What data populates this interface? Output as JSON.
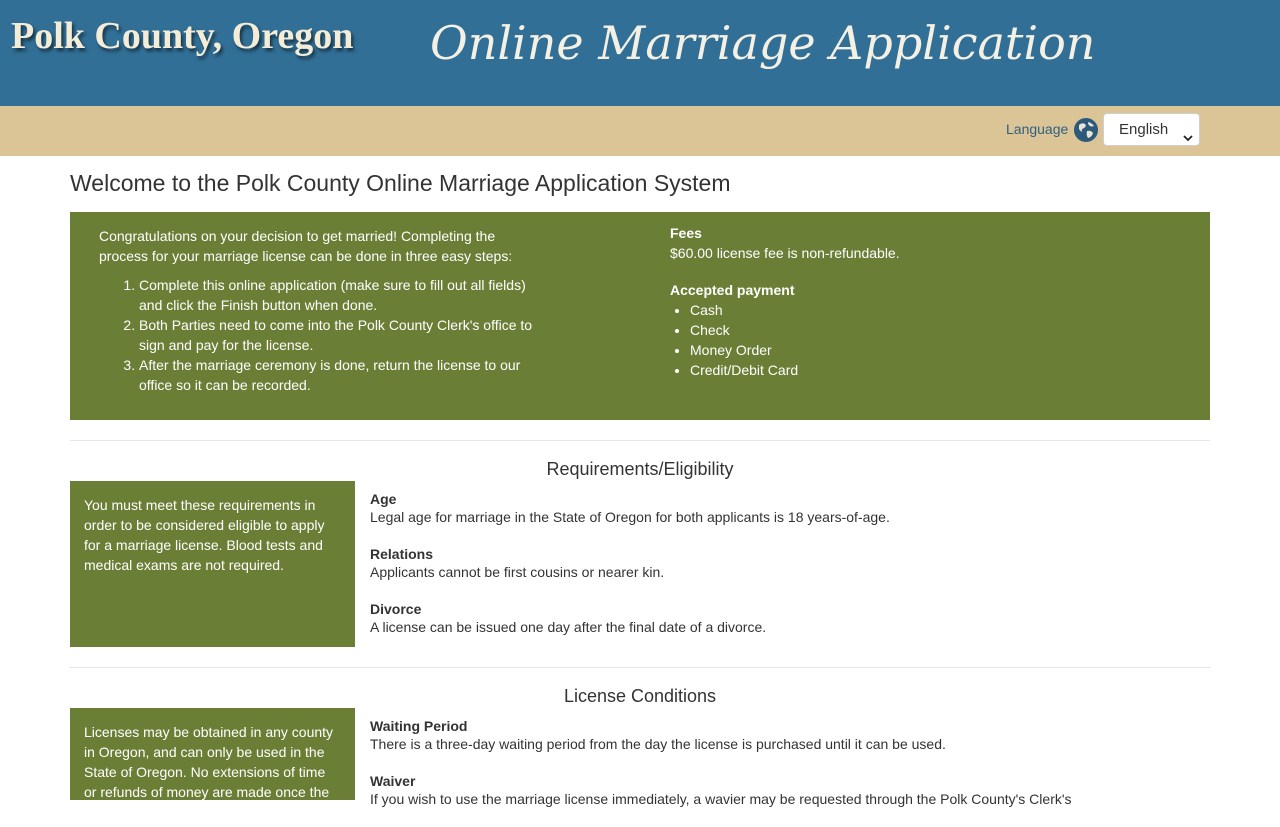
{
  "header": {
    "brand": "Polk County, Oregon",
    "app_title": "Online Marriage Application"
  },
  "language_bar": {
    "label": "Language",
    "icon": "globe-icon",
    "selected": "English"
  },
  "page_title": "Welcome to the Polk County Online Marriage Application System",
  "intro": {
    "text": "Congratulations on your decision to get married! Completing the process for your marriage license can be done in three easy steps:",
    "steps": [
      "Complete this online application (make sure to fill out all fields) and click the Finish button when done.",
      "Both Parties need to come into the Polk County Clerk's office to sign and pay for the license.",
      "After the marriage ceremony is done, return the license to our office so it can be recorded."
    ],
    "fees_label": "Fees",
    "fees_text": "$60.00 license fee is non-refundable.",
    "payment_label": "Accepted payment",
    "payment_methods": [
      "Cash",
      "Check",
      "Money Order",
      "Credit/Debit Card"
    ]
  },
  "requirements": {
    "title": "Requirements/Eligibility",
    "side_text": "You must meet these requirements in order to be considered eligible to apply for a marriage license. Blood tests and medical exams are not required.",
    "items": [
      {
        "label": "Age",
        "text": "Legal age for marriage in the State of Oregon for both applicants is 18 years-of-age."
      },
      {
        "label": "Relations",
        "text": "Applicants cannot be first cousins or nearer kin."
      },
      {
        "label": "Divorce",
        "text": "A license can be issued one day after the final date of a divorce."
      }
    ]
  },
  "conditions": {
    "title": "License Conditions",
    "side_text": "Licenses may be obtained in any county in Oregon, and can only be used in the State of Oregon. No extensions of time or refunds of money are made once the",
    "items": [
      {
        "label": "Waiting Period",
        "text": "There is a three-day waiting period from the day the license is purchased until it can be used."
      },
      {
        "label": "Waiver",
        "text": "If you wish to use the marriage license immediately, a wavier may be requested through the Polk County's Clerk's"
      }
    ]
  },
  "colors": {
    "header_blue": "#316f96",
    "tan_bar": "#dbc496",
    "olive_panel": "#6b7e35"
  }
}
